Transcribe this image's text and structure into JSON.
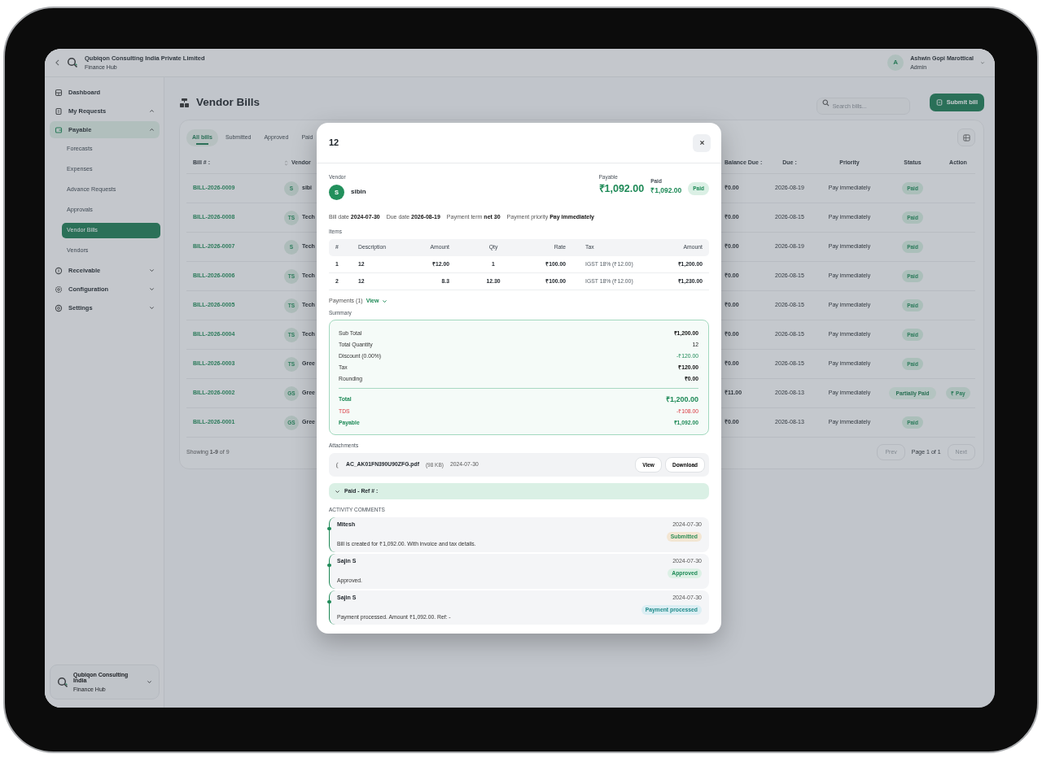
{
  "header": {
    "company": "Qubiqon Consulting India Private Limited",
    "subtitle": "Finance Hub",
    "user": {
      "initial": "A",
      "name": "Ashwin Gopi Marottical",
      "role": "Admin"
    }
  },
  "sidebar": {
    "items": [
      {
        "label": "Dashboard",
        "selected": false
      },
      {
        "label": "My Requests",
        "selected": false,
        "expanded": true
      },
      {
        "label": "Payable",
        "selected": true,
        "expanded": true,
        "children": [
          {
            "label": "Forecasts",
            "selected": false
          },
          {
            "label": "Expenses",
            "selected": false
          },
          {
            "label": "Advance Requests",
            "selected": false
          },
          {
            "label": "Approvals",
            "selected": false
          },
          {
            "label": "Vendor Bills",
            "selected": true
          },
          {
            "label": "Vendors",
            "selected": false
          }
        ]
      },
      {
        "label": "Receivable",
        "selected": false,
        "expanded": false
      },
      {
        "label": "Configuration",
        "selected": false,
        "expanded": false
      },
      {
        "label": "Settings",
        "selected": false,
        "expanded": false
      }
    ],
    "footer": {
      "company": "Qubiqon Consulting India",
      "subtitle": "Finance Hub"
    }
  },
  "page": {
    "title": "Vendor Bills",
    "search": {
      "placeholder": "Search bills..."
    },
    "submit": "Submit bill"
  },
  "tabs": [
    {
      "label": "All bills",
      "selected": true
    },
    {
      "label": "Submitted",
      "selected": false
    },
    {
      "label": "Approved",
      "selected": false
    },
    {
      "label": "Paid",
      "selected": false
    }
  ],
  "table": {
    "columns": [
      "Bill # :",
      "Vendor",
      "Balance Due :",
      "Due :",
      "Priority",
      "Status",
      "Action"
    ],
    "rows": [
      {
        "bill": "BILL-2026-0009",
        "initials": "S",
        "vendor": "sibi",
        "balance": "₹0.00",
        "due": "2026-08-19",
        "priority": "Pay immediately",
        "status": {
          "label": "Paid",
          "kind": "paid"
        }
      },
      {
        "bill": "BILL-2026-0008",
        "initials": "TS",
        "vendor": "Tech",
        "balance": "₹0.00",
        "due": "2026-08-15",
        "priority": "Pay immediately",
        "status": {
          "label": "Paid",
          "kind": "paid"
        }
      },
      {
        "bill": "BILL-2026-0007",
        "initials": "S",
        "vendor": "Tech",
        "balance": "₹0.00",
        "due": "2026-08-19",
        "priority": "Pay immediately",
        "status": {
          "label": "Paid",
          "kind": "paid"
        }
      },
      {
        "bill": "BILL-2026-0006",
        "initials": "TS",
        "vendor": "Tech",
        "balance": "₹0.00",
        "due": "2026-08-15",
        "priority": "Pay immediately",
        "status": {
          "label": "Paid",
          "kind": "paid"
        }
      },
      {
        "bill": "BILL-2026-0005",
        "initials": "TS",
        "vendor": "Tech",
        "balance": "₹0.00",
        "due": "2026-08-15",
        "priority": "Pay immediately",
        "status": {
          "label": "Paid",
          "kind": "paid"
        }
      },
      {
        "bill": "BILL-2026-0004",
        "initials": "TS",
        "vendor": "Tech",
        "balance": "₹0.00",
        "due": "2026-08-15",
        "priority": "Pay immediately",
        "status": {
          "label": "Paid",
          "kind": "paid"
        }
      },
      {
        "bill": "BILL-2026-0003",
        "initials": "TS",
        "vendor": "Gree",
        "balance": "₹0.00",
        "due": "2026-08-15",
        "priority": "Pay immediately",
        "status": {
          "label": "Paid",
          "kind": "paid"
        }
      },
      {
        "bill": "BILL-2026-0002",
        "initials": "GS",
        "vendor": "Gree",
        "balance": "₹11.00",
        "due": "2026-08-13",
        "priority": "Pay immediately",
        "status": {
          "label": "Partially Paid",
          "kind": "partial"
        },
        "action": "₹ Pay"
      },
      {
        "bill": "BILL-2026-0001",
        "initials": "GS",
        "vendor": "Gree",
        "balance": "₹0.00",
        "due": "2026-08-13",
        "priority": "Pay immediately",
        "status": {
          "label": "Paid",
          "kind": "paid"
        }
      }
    ],
    "showing": "Showing **1-9** of 9",
    "prev": {
      "label": "Prev",
      "disabled": true
    },
    "page": "Page 1 of 1",
    "next": {
      "label": "Next",
      "disabled": true
    }
  },
  "modal": {
    "title": "12",
    "vendor_label": "Vendor",
    "vendor": {
      "initial": "S",
      "name": "sibin"
    },
    "payable_label": "Payable",
    "payable": "₹1,092.00",
    "paid_label": "Paid",
    "paid": "₹1,092.00",
    "status": "Paid",
    "meta": [
      {
        "label": "Bill date",
        "value": "2024-07-30"
      },
      {
        "label": "Due date",
        "value": "2026-08-19"
      },
      {
        "label": "Payment term",
        "value": "net 30"
      },
      {
        "label": "Payment priority",
        "value": "Pay immediately"
      }
    ],
    "items_label": "Items",
    "items": {
      "columns": [
        "#",
        "Description",
        "Amount",
        "Qty",
        "Rate",
        "Tax",
        "Amount"
      ],
      "rows": [
        [
          "1",
          "12",
          "₹12.00",
          "1",
          "₹100.00",
          "IGST 18% (₹12.00)",
          "₹1,200.00"
        ],
        [
          "2",
          "12",
          "8.3",
          "12.30",
          "₹100.00",
          "IGST 18% (₹12.00)",
          "₹1,230.00"
        ]
      ]
    },
    "payments": "Payments (1)",
    "payments_link": "View",
    "summary_label": "Summary",
    "summary": [
      {
        "label": "Sub Total",
        "value": "₹1,200.00",
        "kind": "bold"
      },
      {
        "label": "Total Quantity",
        "value": "12",
        "kind": "plain"
      },
      {
        "label": "Discount (0.00%)",
        "value": "-₹120.00",
        "kind": "discount"
      },
      {
        "label": "Tax",
        "value": "₹120.00",
        "kind": "bold"
      },
      {
        "label": "Rounding",
        "value": "₹0.00",
        "kind": "bold"
      },
      {
        "label": "Total",
        "value": "₹1,200.00",
        "kind": "total"
      },
      {
        "label": "TDS",
        "value": "-₹108.00",
        "kind": "tds"
      },
      {
        "label": "Payable",
        "value": "₹1,092.00",
        "kind": "payable"
      }
    ],
    "attachments_label": "Attachments",
    "attachment": {
      "name": "AC_AK01FN390U90ZFG.pdf",
      "size": "(98 KB)",
      "date": "2024-07-30",
      "view": "View",
      "download": "Download"
    },
    "paid_panel": {
      "label": "Paid - Ref # :",
      "expanded": false
    },
    "activity_label": "ACTIVITY COMMENTS",
    "activity": [
      {
        "author": "Mitesh",
        "date": "2024-07-30",
        "text": "Bill is created for ₹1,092.00. With invoice and tax details.",
        "status": {
          "label": "Submitted",
          "kind": "submitted"
        }
      },
      {
        "author": "Sajin S",
        "date": "2024-07-30",
        "text": "Approved.",
        "status": {
          "label": "Approved",
          "kind": "approved"
        }
      },
      {
        "author": "Sajin S",
        "date": "2024-07-30",
        "text": "Payment processed. Amount ₹1,092.00. Ref: -",
        "status": {
          "label": "Payment processed",
          "kind": "processed"
        }
      }
    ]
  }
}
